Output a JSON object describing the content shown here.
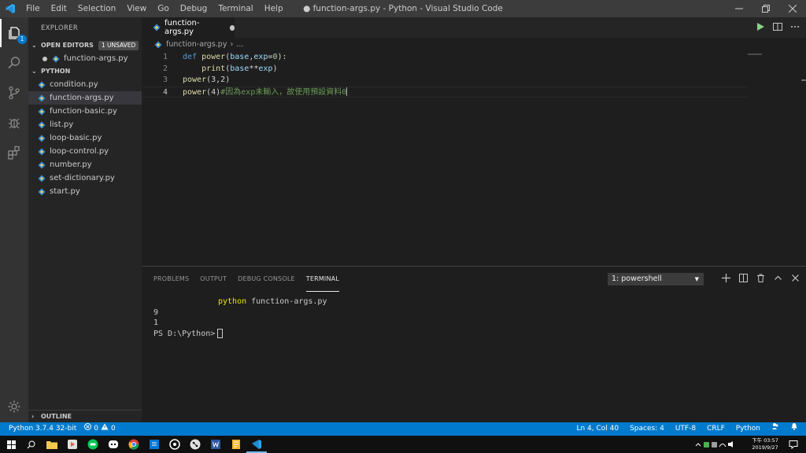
{
  "window": {
    "title": "● function-args.py - Python - Visual Studio Code",
    "menu": [
      "File",
      "Edit",
      "Selection",
      "View",
      "Go",
      "Debug",
      "Terminal",
      "Help"
    ]
  },
  "activity_bar": {
    "items": [
      "explorer-icon",
      "search-icon",
      "source-control-icon",
      "debug-icon",
      "extensions-icon"
    ],
    "explorer_badge": "1",
    "bottom": "gear-icon"
  },
  "sidebar": {
    "title": "EXPLORER",
    "open_editors": {
      "label": "OPEN EDITORS",
      "badge": "1 UNSAVED",
      "files": [
        "function-args.py"
      ]
    },
    "folder": {
      "label": "PYTHON",
      "files": [
        "condition.py",
        "function-args.py",
        "function-basic.py",
        "list.py",
        "loop-basic.py",
        "loop-control.py",
        "number.py",
        "set-dictionary.py",
        "start.py"
      ],
      "selected": "function-args.py"
    },
    "outline_label": "OUTLINE"
  },
  "editor": {
    "tab_label": "function-args.py",
    "breadcrumb": [
      "function-args.py",
      "..."
    ],
    "line_numbers": [
      "1",
      "2",
      "3",
      "4"
    ],
    "lines": {
      "l1": {
        "kw": "def",
        "fn": "power",
        "p1": "base",
        "p2": "exp",
        "num": "0",
        "end": "):"
      },
      "l2": {
        "indent": "    ",
        "fn": "print",
        "open": "(",
        "p1": "base",
        "op": "**",
        "p2": "exp",
        "close": ")"
      },
      "l3": {
        "fn": "power",
        "args": "(3,2)"
      },
      "l4": {
        "fn": "power",
        "args": "(4)",
        "comment": "#因為exp未輸入，故使用預設資料0"
      }
    }
  },
  "panel": {
    "tabs": [
      "PROBLEMS",
      "OUTPUT",
      "DEBUG CONSOLE",
      "TERMINAL"
    ],
    "active_tab": "TERMINAL",
    "terminal_select": "1: powershell",
    "terminal_lines": {
      "cmd_word": "python",
      "cmd_arg": " function-args.py",
      "out1": "9",
      "out2": "1",
      "prompt": "PS D:\\Python>"
    }
  },
  "statusbar": {
    "interpreter": "Python 3.7.4 32-bit",
    "errors": "0",
    "warnings": "0",
    "position": "Ln 4, Col 40",
    "spaces": "Spaces: 4",
    "encoding": "UTF-8",
    "eol": "CRLF",
    "language": "Python"
  },
  "taskbar": {
    "time": "下午 03:57",
    "date": "2019/9/27"
  },
  "colors": {
    "accent": "#007acc",
    "keyword": "#569cd6",
    "function": "#dcdcaa",
    "param": "#9cdcfe",
    "number": "#b5cea8",
    "comment": "#6a9955"
  }
}
